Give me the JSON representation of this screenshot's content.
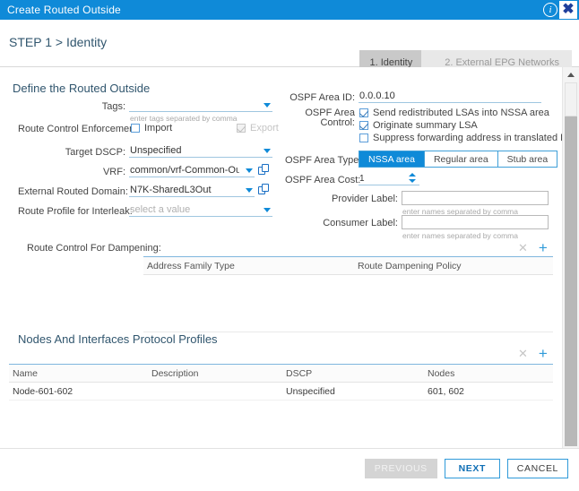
{
  "window": {
    "title": "Create Routed Outside",
    "info_icon": "info-icon",
    "close_icon": "close-icon"
  },
  "step_header": {
    "title": "STEP 1 > Identity",
    "steps": [
      {
        "label": "1. Identity",
        "active": true
      },
      {
        "label": "2. External EPG Networks",
        "active": false
      }
    ]
  },
  "define_section": {
    "title": "Define the Routed Outside",
    "tags": {
      "label": "Tags:",
      "value": "",
      "hint": "enter tags separated by comma",
      "caret_icon": "chevron-down-icon"
    },
    "route_control_enforcement": {
      "label": "Route Control Enforcement:",
      "import": {
        "label": "Import",
        "checked": false
      },
      "export": {
        "label": "Export",
        "checked": true,
        "disabled": true
      }
    },
    "target_dscp": {
      "label": "Target DSCP:",
      "value": "Unspecified",
      "caret_icon": "chevron-down-icon"
    },
    "vrf": {
      "label": "VRF:",
      "value": "common/vrf-Common-Outside",
      "caret_icon": "chevron-down-icon",
      "link_icon": "open-in-new-icon"
    },
    "external_routed_domain": {
      "label": "External Routed Domain:",
      "value": "N7K-SharedL3Out",
      "caret_icon": "chevron-down-icon",
      "link_icon": "open-in-new-icon"
    },
    "route_profile_interleak": {
      "label": "Route Profile for Interleak:",
      "placeholder": "select a value",
      "caret_icon": "chevron-down-icon"
    }
  },
  "ospf": {
    "area_id": {
      "label": "OSPF Area ID:",
      "value": "0.0.0.10"
    },
    "area_control": {
      "label_line1": "OSPF Area",
      "label_line2": "Control:",
      "options": [
        {
          "label": "Send redistributed LSAs into NSSA area",
          "checked": true
        },
        {
          "label": "Originate summary LSA",
          "checked": true
        },
        {
          "label": "Suppress forwarding address in translated LSA",
          "checked": false
        }
      ]
    },
    "area_type": {
      "label": "OSPF Area Type:",
      "options": [
        "NSSA area",
        "Regular area",
        "Stub area"
      ],
      "selected": "NSSA area"
    },
    "area_cost": {
      "label": "OSPF Area Cost:",
      "value": "1",
      "up_icon": "spinner-up-icon",
      "down_icon": "spinner-down-icon"
    },
    "provider_label": {
      "label": "Provider Label:",
      "value": "",
      "hint": "enter names separated by comma"
    },
    "consumer_label": {
      "label": "Consumer Label:",
      "value": "",
      "hint": "enter names separated by comma"
    }
  },
  "dampening": {
    "label": "Route Control For Dampening:",
    "remove_icon": "close-x-icon",
    "add_icon": "plus-icon",
    "columns": [
      "Address Family Type",
      "Route Dampening Policy"
    ],
    "rows": []
  },
  "nodes_section": {
    "title": "Nodes And Interfaces Protocol Profiles",
    "remove_icon": "close-x-icon",
    "add_icon": "plus-icon",
    "columns": [
      "Name",
      "Description",
      "DSCP",
      "Nodes"
    ],
    "rows": [
      {
        "name": "Node-601-602",
        "description": "",
        "dscp": "Unspecified",
        "nodes": "601, 602"
      }
    ]
  },
  "footer": {
    "previous": "PREVIOUS",
    "next": "NEXT",
    "cancel": "CANCEL"
  },
  "colors": {
    "title_bar": "#0f8ad8",
    "accent": "#0f8ad8",
    "step_active": "#c9c9c9",
    "step_inactive": "#e8e8e8",
    "field_underline": "#9fc6e0"
  }
}
